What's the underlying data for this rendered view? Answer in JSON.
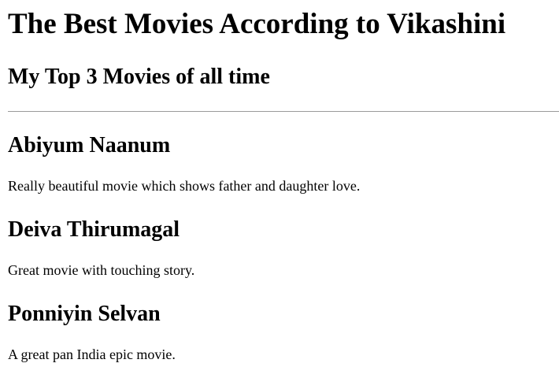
{
  "header": {
    "title": "The Best Movies According to Vikashini",
    "subtitle": "My Top 3 Movies of all time"
  },
  "movies": [
    {
      "title": "Abiyum Naanum",
      "description": "Really beautiful movie which shows father and daughter love."
    },
    {
      "title": "Deiva Thirumagal",
      "description": "Great movie with touching story."
    },
    {
      "title": "Ponniyin Selvan",
      "description": "A great pan India epic movie."
    }
  ]
}
